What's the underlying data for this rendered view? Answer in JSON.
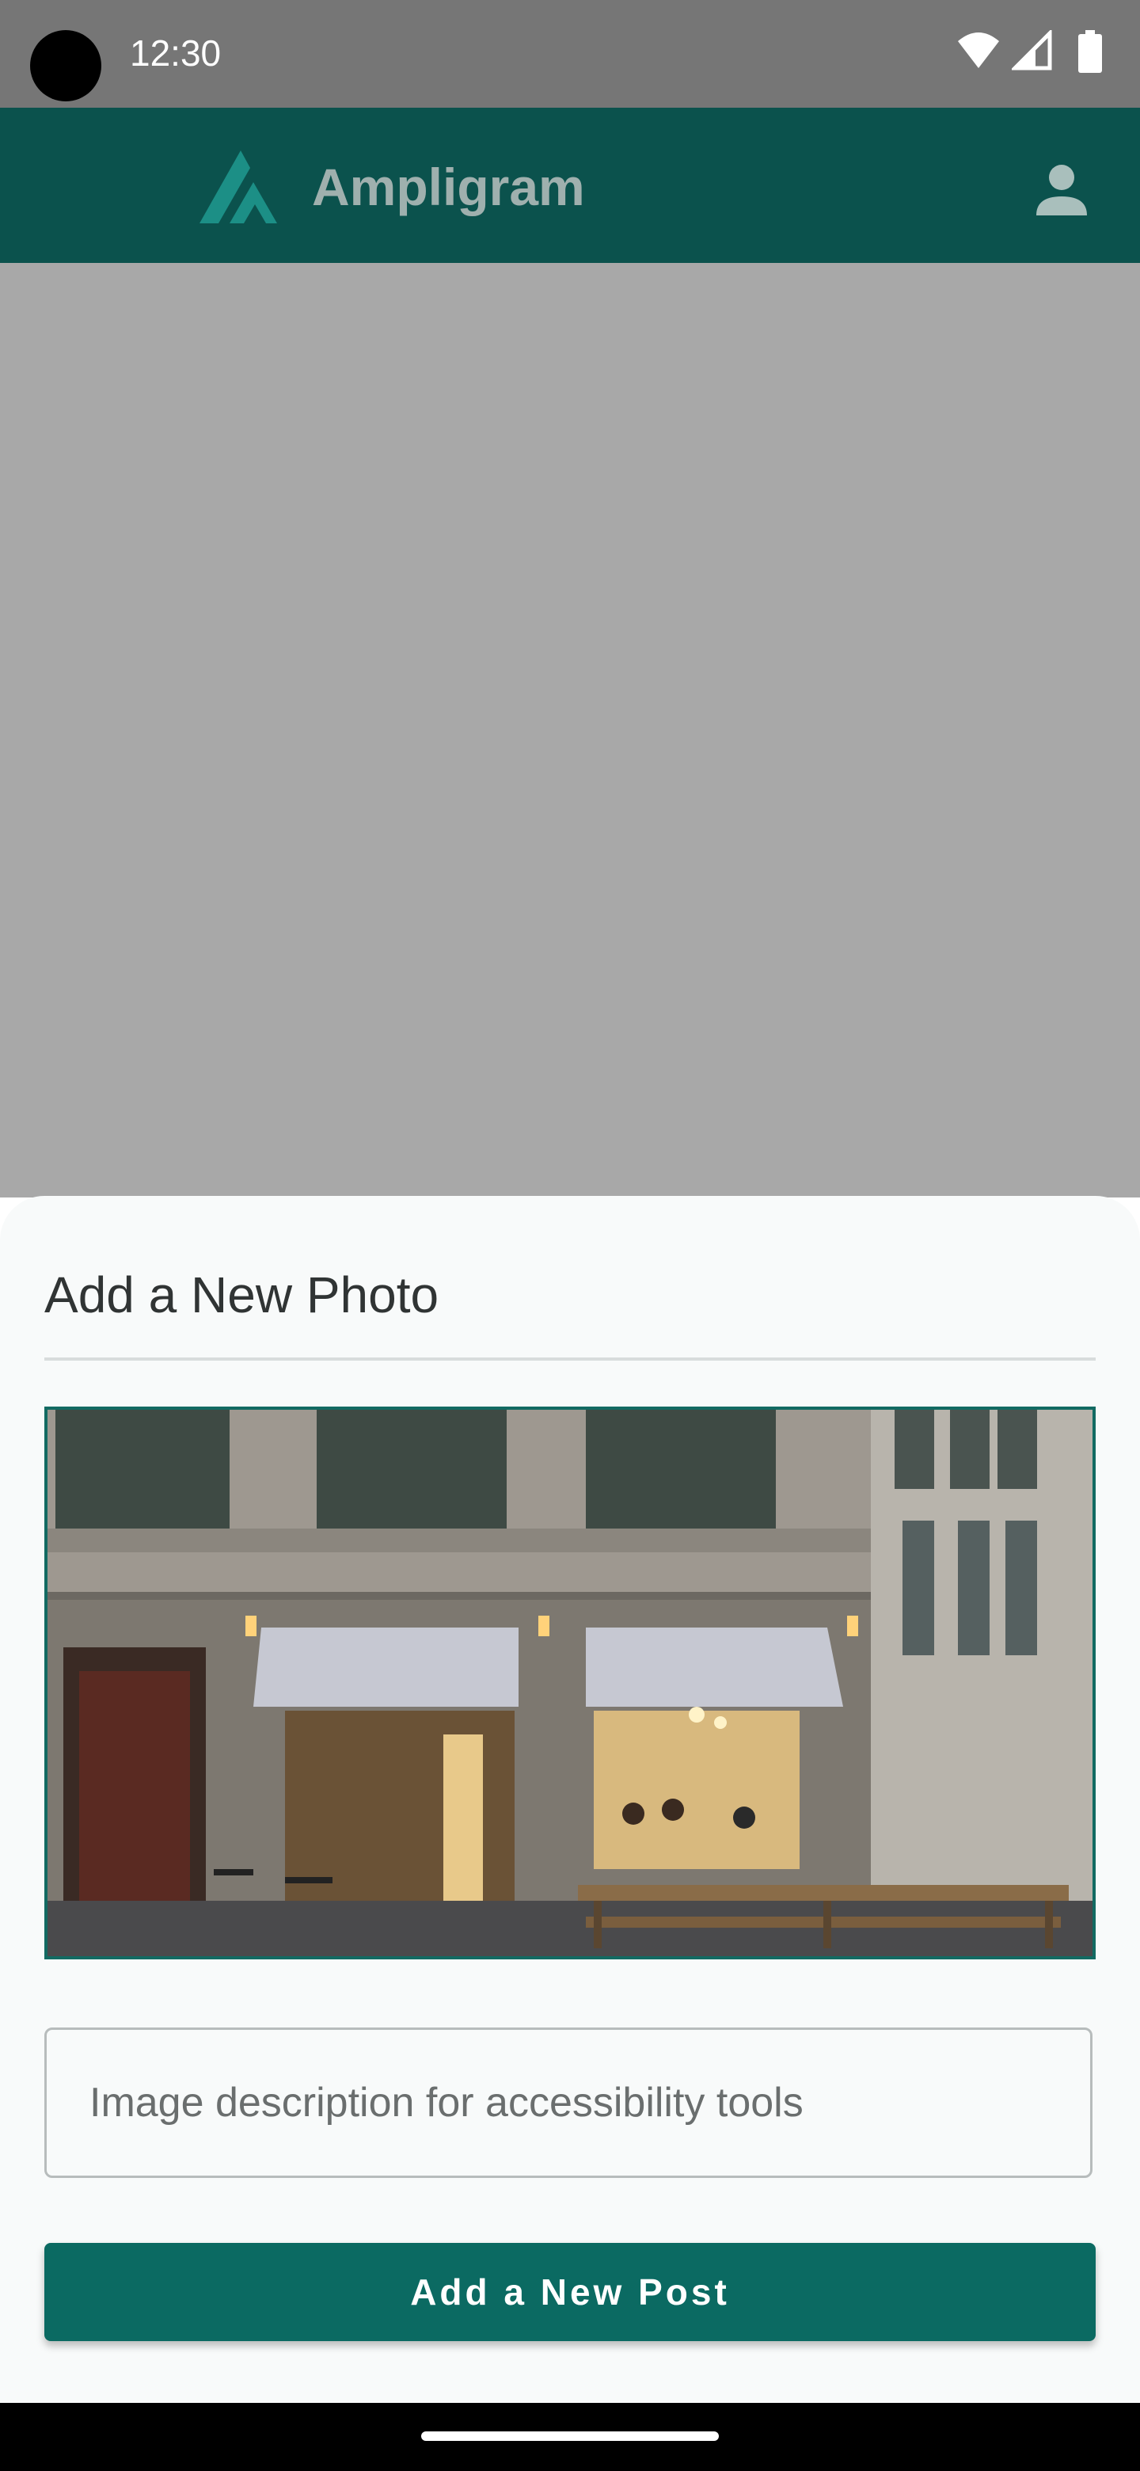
{
  "status_bar": {
    "time": "12:30",
    "icons": [
      "camera-cutout",
      "wifi-icon",
      "signal-icon",
      "battery-icon"
    ]
  },
  "app_bar": {
    "title": "Ampligram",
    "logo_icon": "ampligram-logo-icon",
    "profile_icon": "person-icon",
    "background_color": "#0b524d"
  },
  "sheet": {
    "title": "Add a New Photo",
    "description_input": {
      "placeholder": "Image description for accessibility tools",
      "value": ""
    },
    "submit_label": "Add a New Post",
    "accent_color": "#0b6a62"
  }
}
